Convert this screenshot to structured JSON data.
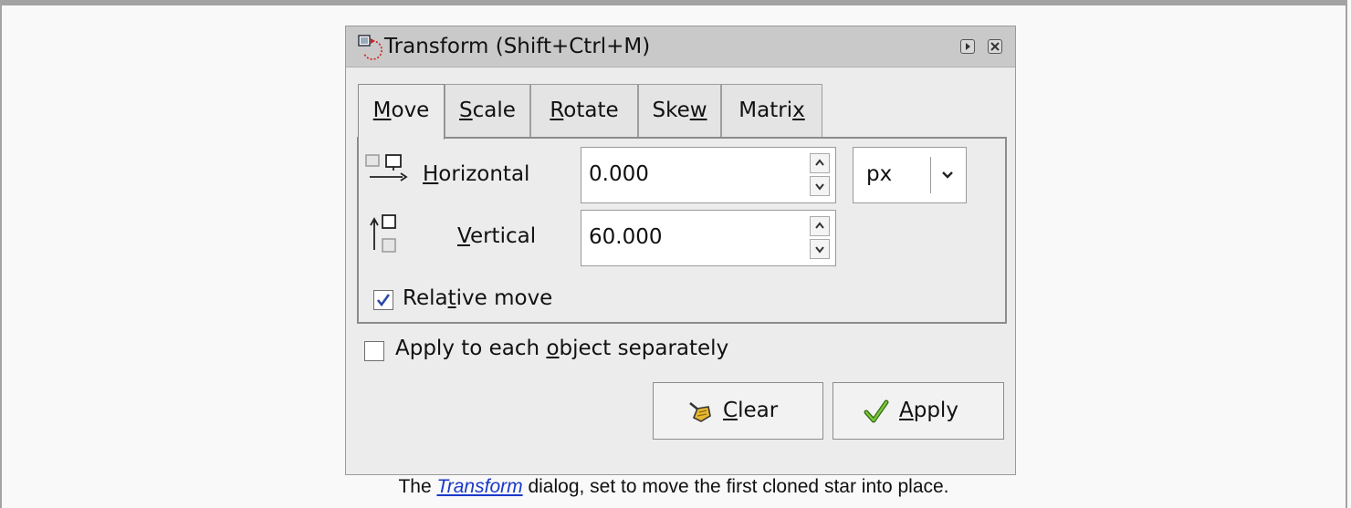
{
  "dialog": {
    "title": "Transform (Shift+Ctrl+M)",
    "title_icon": "transform-icon",
    "title_buttons": [
      "collapse-icon",
      "close-icon"
    ]
  },
  "tabs": [
    {
      "label": "Move",
      "mnemonic": "M",
      "active": true
    },
    {
      "label": "Scale",
      "mnemonic": "S",
      "active": false
    },
    {
      "label": "Rotate",
      "mnemonic": "R",
      "active": false
    },
    {
      "label": "Skew",
      "mnemonic": "w",
      "active": false
    },
    {
      "label": "Matrix",
      "mnemonic": "x",
      "active": false
    }
  ],
  "move": {
    "horizontal_label": "Horizontal",
    "horizontal_value": "0.000",
    "vertical_label": "Vertical",
    "vertical_value": "60.000",
    "unit": "px",
    "relative_move_label": "Relative move",
    "relative_move_checked": true
  },
  "apply_each_label": "Apply to each object separately",
  "apply_each_checked": false,
  "buttons": {
    "clear_label": "Clear",
    "apply_label": "Apply"
  },
  "caption": {
    "prefix": "The ",
    "link": "Transform",
    "suffix": " dialog, set to move the first cloned star into place."
  },
  "colors": {
    "link": "#1a39c9",
    "titlebar": "#c9c9c9",
    "dialog_bg": "#ececec"
  }
}
